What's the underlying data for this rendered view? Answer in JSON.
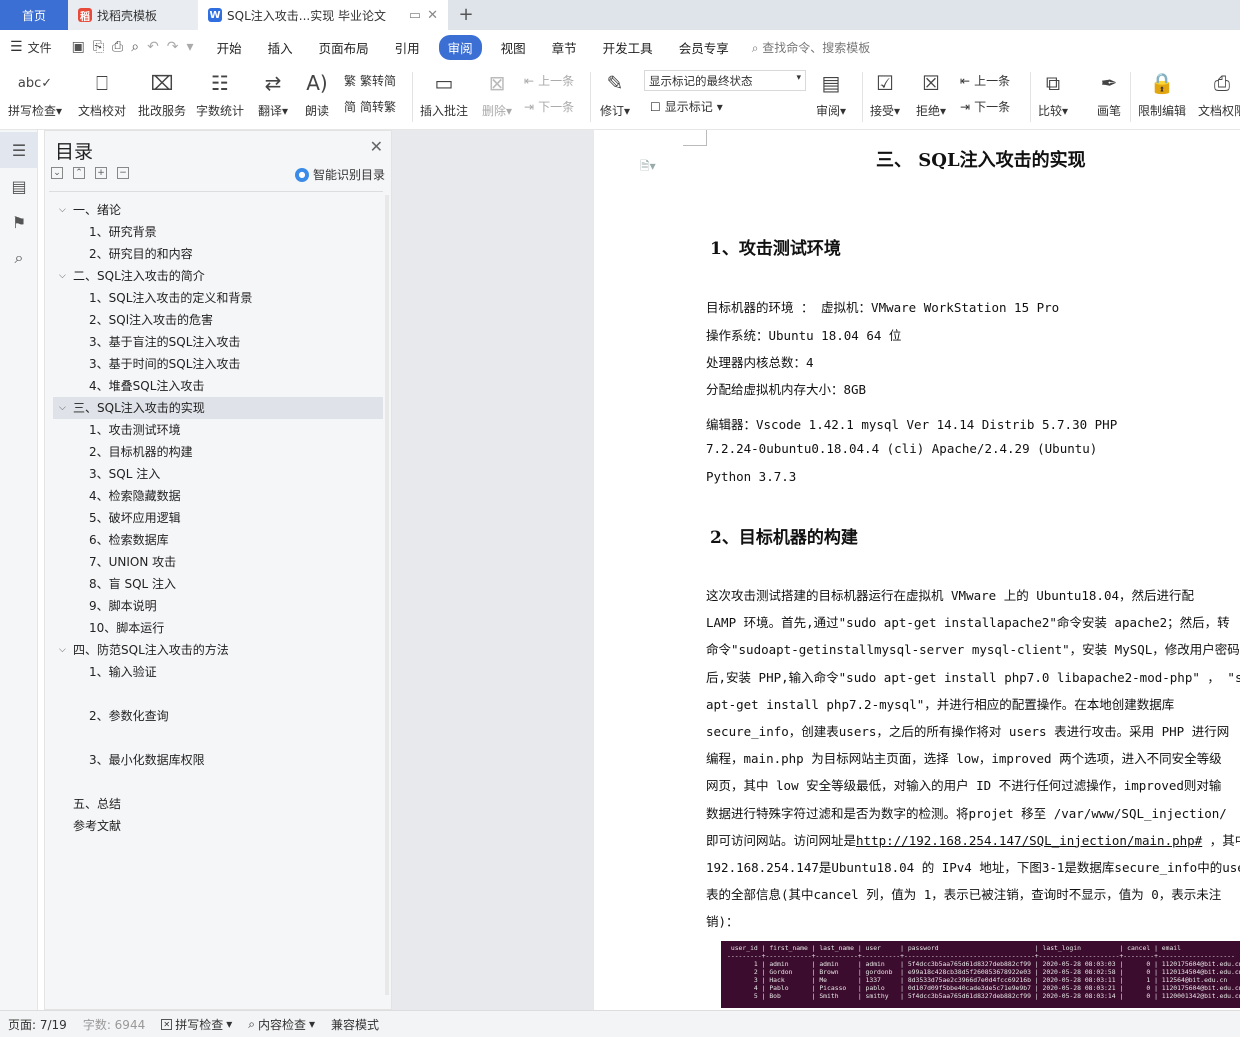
{
  "tabs": {
    "home": "首页",
    "doc1": "找稻壳模板",
    "doc2": "SQL注入攻击...实现 毕业论文",
    "plus": "+"
  },
  "menu": {
    "file": "文件",
    "items": [
      "开始",
      "插入",
      "页面布局",
      "引用",
      "审阅",
      "视图",
      "章节",
      "开发工具",
      "会员专享"
    ],
    "active": "审阅",
    "search": "查找命令、搜索模板"
  },
  "ribbon": {
    "spell_check": "拼写检查",
    "doc_proof": "文档校对",
    "batch_service": "批改服务",
    "word_count": "字数统计",
    "translate": "翻译",
    "read_aloud": "朗读",
    "trad_to_simp": "繁转简",
    "simp_to_trad": "简转繁",
    "insert_comment": "插入批注",
    "delete": "删除",
    "prev": "上一条",
    "next": "下一条",
    "revise": "修订",
    "markup_select": "显示标记的最终状态",
    "show_markup": "显示标记",
    "review": "审阅",
    "accept": "接受",
    "reject": "拒绝",
    "prev2": "上一条",
    "next2": "下一条",
    "compare": "比较",
    "pen": "画笔",
    "restrict_edit": "限制编辑",
    "doc_rights": "文档权限"
  },
  "outline": {
    "title": "目录",
    "smart": "智能识别目录",
    "items": [
      {
        "level": 1,
        "text": "一、绪论",
        "collapsible": true
      },
      {
        "level": 2,
        "text": "1、研究背景"
      },
      {
        "level": 2,
        "text": "2、研究目的和内容"
      },
      {
        "level": 1,
        "text": "二、SQL注入攻击的简介",
        "collapsible": true
      },
      {
        "level": 2,
        "text": "1、SQL注入攻击的定义和背景"
      },
      {
        "level": 2,
        "text": "2、SQl注入攻击的危害"
      },
      {
        "level": 2,
        "text": "3、基于盲注的SQL注入攻击"
      },
      {
        "level": 2,
        "text": "3、基于时间的SQL注入攻击"
      },
      {
        "level": 2,
        "text": "4、堆叠SQL注入攻击"
      },
      {
        "level": 1,
        "text": "三、SQL注入攻击的实现",
        "collapsible": true,
        "selected": true
      },
      {
        "level": 2,
        "text": "1、攻击测试环境"
      },
      {
        "level": 2,
        "text": "2、目标机器的构建"
      },
      {
        "level": 2,
        "text": "3、SQL 注入"
      },
      {
        "level": 2,
        "text": "4、检索隐藏数据"
      },
      {
        "level": 2,
        "text": "5、破坏应用逻辑"
      },
      {
        "level": 2,
        "text": "6、检索数据库"
      },
      {
        "level": 2,
        "text": "7、UNION 攻击"
      },
      {
        "level": 2,
        "text": "8、盲 SQL 注入"
      },
      {
        "level": 2,
        "text": "9、脚本说明"
      },
      {
        "level": 2,
        "text": "10、脚本运行"
      },
      {
        "level": 1,
        "text": "四、防范SQL注入攻击的方法",
        "collapsible": true
      },
      {
        "level": 2,
        "text": "1、输入验证",
        "gap_after": true
      },
      {
        "level": 2,
        "text": "2、参数化查询",
        "gap_after": true
      },
      {
        "level": 2,
        "text": "3、最小化数据库权限",
        "gap_after": true
      },
      {
        "level": 1,
        "text": "五、总结"
      },
      {
        "level": 1,
        "text": "参考文献"
      }
    ]
  },
  "document": {
    "heading": "三、  SQL注入攻击的实现",
    "sec1": "1、攻击测试环境",
    "env": [
      "目标机器的环境 ： 虚拟机：VMware WorkStation 15  Pro",
      " 操作系统：Ubuntu 18.04  64 位",
      " 处理器内核总数：4",
      " 分配给虚拟机内存大小：8GB",
      " 编辑器：Vscode 1.42.1 mysql    Ver   14.14  Distrib  5.7.30 PHP",
      " 7.2.24-0ubuntu0.18.04.4 (cli) Apache/2.4.29 (Ubuntu)",
      " Python 3.7.3"
    ],
    "sec2": "2、目标机器的构建",
    "para": [
      "    这次攻击测试搭建的目标机器运行在虚拟机 VMware 上的 Ubuntu18.04，然后进行配",
      "LAMP  环境。首先,通过\"sudo  apt-get  installapache2\"命令安装 apache2；然后，转",
      "命令\"sudoapt-getinstallmysql-server mysql-client\"，安装 MySQL，修改用户密码；",
      "后,安装 PHP,输入命令\"sudo apt-get install php7.0 libapache2-mod-php\" ，  \"sudo",
      "apt-get install php7.2-mysql\"，并进行相应的配置操作。在本地创建数据库",
      "secure_info，创建表users，之后的所有操作将对 users 表进行攻击。采用 PHP 进行网",
      "编程，main.php 为目标网站主页面，选择 low，improved 两个选项，进入不同安全等级",
      "网页，其中 low 安全等级最低，对输入的用户 ID 不进行任何过滤操作，improved则对输",
      "数据进行特殊字符过滤和是否为数字的检测。将projet 移至 /var/www/SQL_injection/",
      "即可访问网站。访问网址是",
      "192.168.254.147是Ubuntu18.04 的 IPv4 地址，下图3-1是数据库secure_info中的use",
      "表的全部信息(其中cancel 列，值为 1，表示已被注销，查询时不显示，值为 0，表示未注",
      "销)："
    ],
    "url": "http://192.168.254.147/SQL_injection/main.php#",
    "url_after": " ，其中",
    "terminal": [
      " user_id | first_name | last_name | user     | password                         | last_login          | cancel | email",
      "---------+------------+-----------+----------+----------------------------------+---------------------+--------+--------------------",
      "       1 | admin      | admin     | admin    | 5f4dcc3b5aa765d61d8327deb882cf99 | 2020-05-28 08:03:03 |      0 | 1120175604@bit.edu.cn",
      "       2 | Gordon     | Brown     | gordonb  | e99a18c428cb38d5f260853678922e03 | 2020-05-28 08:02:58 |      0 | 1120134504@bit.edu.cn",
      "       3 | Hack       | Me        | 1337     | 8d3533d75ae2c3966d7e0d4fcc69216b | 2020-05-28 08:03:11 |      1 | 112564@bit.edu.cn",
      "       4 | Pablo      | Picasso   | pablo    | 0d107d09f5bbe40cade3de5c71e9e9b7 | 2020-05-28 08:03:21 |      0 | 1120175604@bit.edu.cn",
      "       5 | Bob        | Smith     | smithy   | 5f4dcc3b5aa765d61d8327deb882cf99 | 2020-05-28 08:03:14 |      0 | 1120001342@bit.edu.cn"
    ]
  },
  "status": {
    "page": "页面: 7/19",
    "words": "字数: 6944",
    "spell": "拼写检查",
    "content": "内容检查",
    "compat": "兼容模式"
  }
}
